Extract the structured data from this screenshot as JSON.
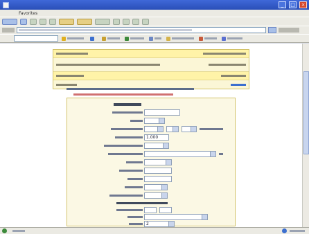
{
  "window": {
    "title": "",
    "controls": {
      "minimize": "_",
      "maximize": "□",
      "close": "×"
    }
  },
  "menu": {
    "items": [
      "",
      "",
      "",
      "Favorites",
      "",
      ""
    ]
  },
  "address": {
    "url": ""
  },
  "linksbar": {
    "logo": "",
    "chips": [
      {
        "icon": "star-icon",
        "color": "#e0b020"
      },
      {
        "icon": "search-icon",
        "color": "#3c6fcf"
      },
      {
        "icon": "mail-icon",
        "color": "#c8a030"
      },
      {
        "icon": "globe-icon",
        "color": "#3c8a3a"
      },
      {
        "icon": "highlight-icon",
        "color": "#d5b34a"
      },
      {
        "icon": "options-icon",
        "color": "#6d88c4"
      }
    ]
  },
  "page": {
    "info_rows": 5,
    "form": {
      "title": "",
      "fields": [
        {
          "label": "",
          "value": "",
          "kind": "text"
        },
        {
          "label": "",
          "value": "",
          "kind": "select"
        },
        {
          "label": "",
          "value": "",
          "kind": "select"
        },
        {
          "label": "",
          "value": "1.000",
          "kind": "text"
        },
        {
          "label": "",
          "value": "",
          "kind": "select"
        },
        {
          "label": "",
          "value": "",
          "kind": "select"
        },
        {
          "label": "",
          "value": "",
          "kind": "select"
        },
        {
          "label": "",
          "value": "",
          "kind": "text"
        },
        {
          "label": "",
          "value": "",
          "kind": "text"
        },
        {
          "label": "",
          "value": "",
          "kind": "select"
        },
        {
          "label": "",
          "value": "",
          "kind": "select"
        },
        {
          "label": "",
          "value": "",
          "kind": "text"
        },
        {
          "label": "",
          "value": "",
          "kind": "select"
        },
        {
          "label": "",
          "value": "2",
          "kind": "select"
        },
        {
          "label": "",
          "value": "",
          "kind": "select"
        }
      ]
    }
  },
  "status": {
    "text": "",
    "zone": ""
  },
  "colors": {
    "titlebar": "#2a4fb8",
    "info_bg": "#fbf6d6",
    "form_bg": "#fbf8e4",
    "warning": "#d07070"
  }
}
